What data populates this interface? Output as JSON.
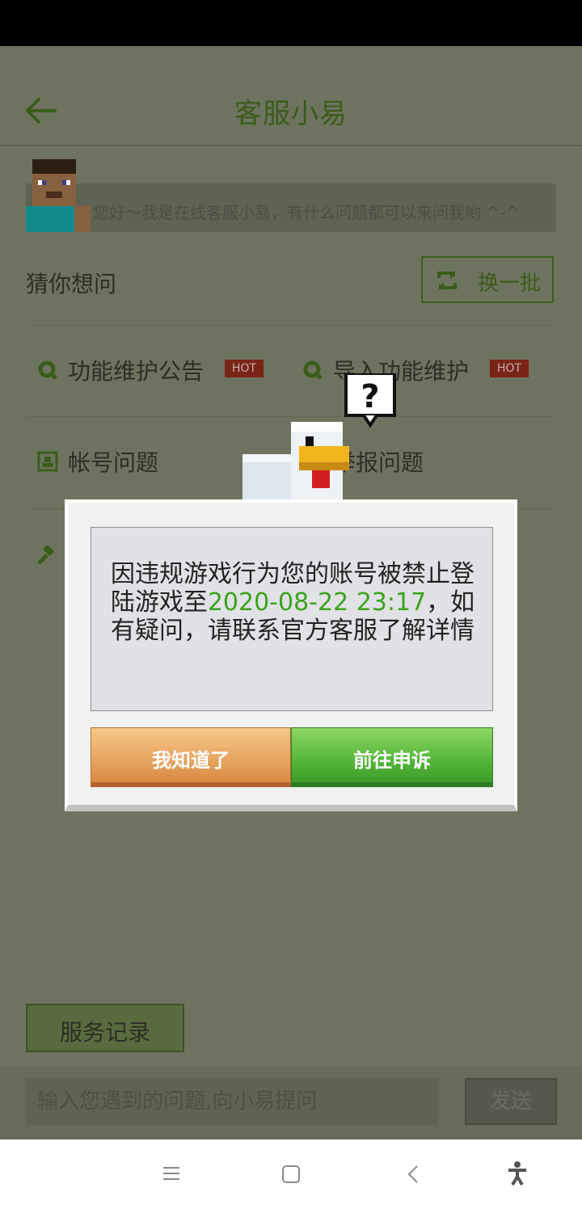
{
  "header": {
    "title": "客服小易"
  },
  "greeting": "您好～我是在线客服小易，有什么问题都可以来问我哟 ^-^",
  "suggest": {
    "title": "猜你想问",
    "refresh_label": "换一批"
  },
  "faq": {
    "items": [
      {
        "label": "功能维护公告",
        "badge": "HOT",
        "icon": "q-icon"
      },
      {
        "label": "导入功能维护",
        "badge": "HOT",
        "icon": "q-icon"
      },
      {
        "label": "帐号问题",
        "icon": "account-icon"
      },
      {
        "label": "举报问题",
        "icon": "report-icon"
      }
    ]
  },
  "service_record_label": "服务记录",
  "input": {
    "placeholder": "输入您遇到的问题,向小易提问",
    "send_label": "发送"
  },
  "dialog": {
    "message_part1": "因违规游戏行为您的账号被禁止登陆游戏至",
    "date_highlight": "2020-08-22 23:17",
    "message_part2": "，如有疑问，请联系官方客服了解详情",
    "dismiss_label": "我知道了",
    "appeal_label": "前往申诉"
  },
  "colors": {
    "accent_green": "#3aa31b",
    "hot_red": "#7a2317",
    "orange_button": "#e8a460"
  }
}
